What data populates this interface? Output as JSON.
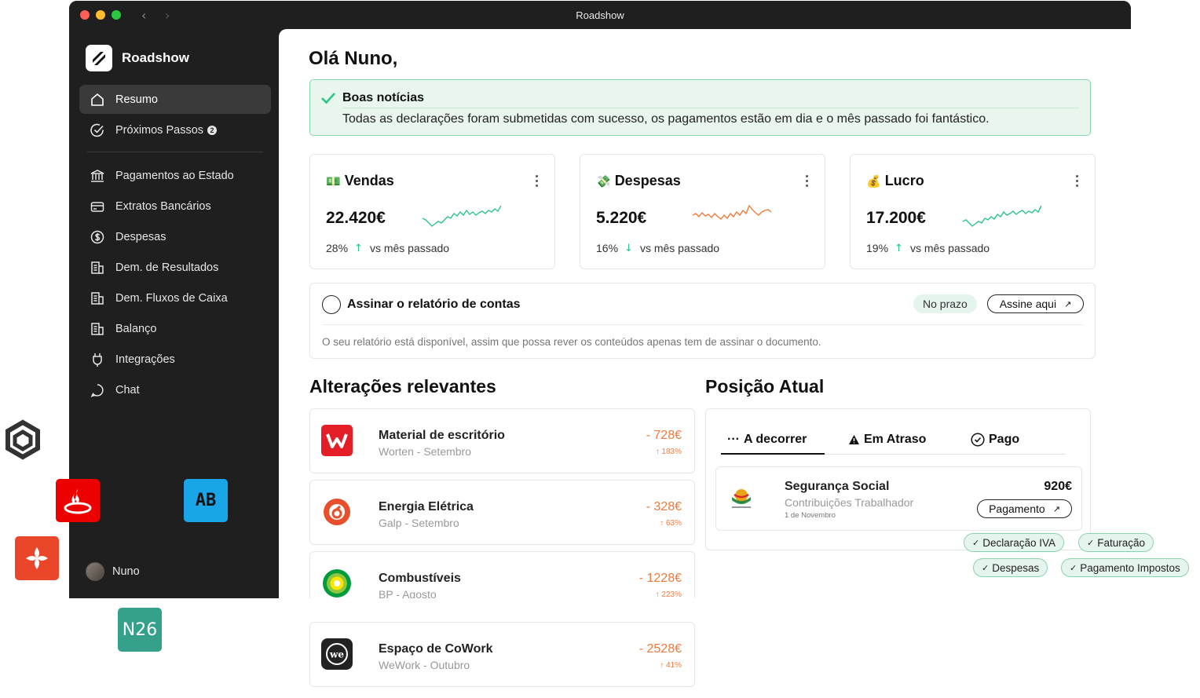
{
  "window": {
    "title": "Roadshow"
  },
  "sidebar": {
    "brand": "Roadshow",
    "items": [
      {
        "label": "Resumo",
        "icon": "home-icon",
        "active": true
      },
      {
        "label": "Próximos Passos",
        "icon": "check-circle-icon",
        "badge": "2"
      },
      {
        "label": "Pagamentos ao Estado",
        "icon": "bank-icon"
      },
      {
        "label": "Extratos Bancários",
        "icon": "card-icon"
      },
      {
        "label": "Despesas",
        "icon": "dollar-icon"
      },
      {
        "label": "Dem. de Resultados",
        "icon": "report-icon"
      },
      {
        "label": "Dem. Fluxos de Caixa",
        "icon": "report-icon"
      },
      {
        "label": "Balanço",
        "icon": "report-icon"
      },
      {
        "label": "Integrações",
        "icon": "plug-icon"
      },
      {
        "label": "Chat",
        "icon": "chat-icon"
      }
    ],
    "user": {
      "name": "Nuno"
    }
  },
  "main": {
    "greeting": "Olá Nuno,",
    "news": {
      "title": "Boas notícias",
      "text": "Todas as declarações foram submetidas com sucesso, os pagamentos estão em dia e o mês passado foi fantástico."
    },
    "kpis": [
      {
        "emoji": "💵",
        "title": "Vendas",
        "value": "22.420€",
        "pct": "28%",
        "direction": "up",
        "compare": "vs mês passado",
        "color": "#2bc48a"
      },
      {
        "emoji": "💸",
        "title": "Despesas",
        "value": "5.220€",
        "pct": "16%",
        "direction": "down",
        "compare": "vs mês passado",
        "color": "#f07a3a"
      },
      {
        "emoji": "💰",
        "title": "Lucro",
        "value": "17.200€",
        "pct": "19%",
        "direction": "up",
        "compare": "vs mês passado",
        "color": "#2bc48a"
      }
    ],
    "task": {
      "title": "Assinar o relatório de contas",
      "status": "No prazo",
      "action": "Assine aqui",
      "description": "O seu relatório está disponível, assim que possa rever os conteúdos apenas tem de assinar o documento."
    },
    "changes": {
      "title": "Alterações relevantes",
      "items": [
        {
          "name": "Material de escritório",
          "sub": "Worten - Setembro",
          "amount": "- 728€",
          "pct": "183%"
        },
        {
          "name": "Energia Elétrica",
          "sub": "Galp - Setembro",
          "amount": "- 328€",
          "pct": "63%"
        },
        {
          "name": "Combustíveis",
          "sub": "BP - Agosto",
          "amount": "- 1228€",
          "pct": "223%"
        },
        {
          "name": "Espaço de CoWork",
          "sub": "WeWork - Outubro",
          "amount": "- 2528€",
          "pct": "41%"
        }
      ]
    },
    "position": {
      "title": "Posição Atual",
      "tabs": [
        "A decorrer",
        "Em Atraso",
        "Pago"
      ],
      "payment": {
        "name": "Segurança Social",
        "sub": "Contribuições Trabalhador",
        "date": "1 de Novembro",
        "amount": "920€",
        "action": "Pagamento"
      }
    }
  },
  "tags": [
    "Declaração IVA",
    "Faturação",
    "Despesas",
    "Pagamento Impostos"
  ],
  "banks": {
    "ab_label": "AB",
    "n26_label": "N26"
  },
  "colors": {
    "accent_green": "#2bc48a",
    "accent_orange": "#f07a3a",
    "sidebar_bg": "#1f1f1f"
  }
}
